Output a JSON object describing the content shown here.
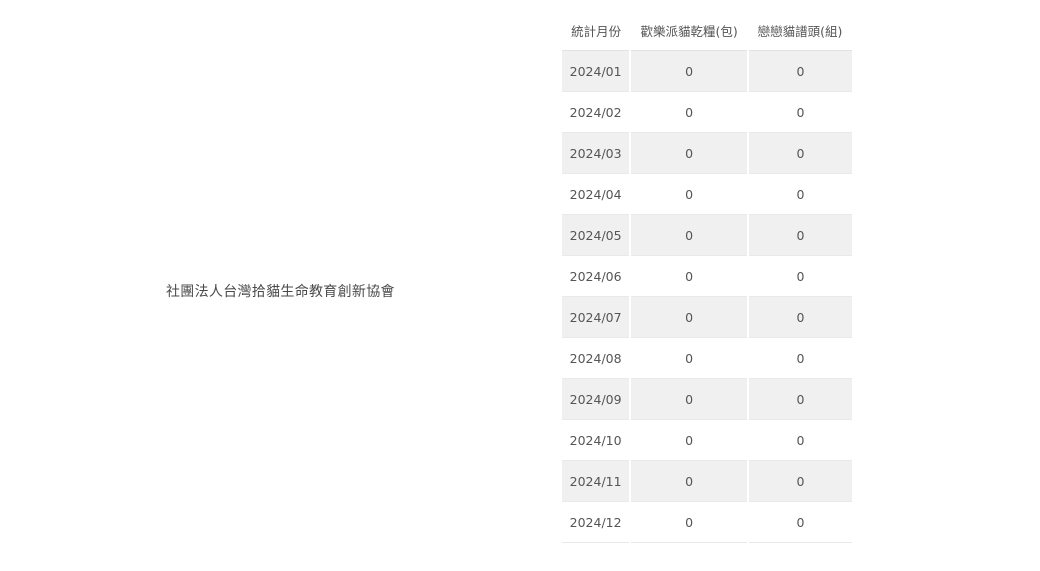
{
  "organization": {
    "name": "社團法人台灣拾貓生命教育創新協會"
  },
  "stats_table": {
    "headers": {
      "month": "統計月份",
      "food": "歡樂派貓乾糧(包)",
      "adopt": "戀戀貓譜頭(組)"
    },
    "rows": [
      {
        "month": "2024/01",
        "food": "0",
        "adopt": "0"
      },
      {
        "month": "2024/02",
        "food": "0",
        "adopt": "0"
      },
      {
        "month": "2024/03",
        "food": "0",
        "adopt": "0"
      },
      {
        "month": "2024/04",
        "food": "0",
        "adopt": "0"
      },
      {
        "month": "2024/05",
        "food": "0",
        "adopt": "0"
      },
      {
        "month": "2024/06",
        "food": "0",
        "adopt": "0"
      },
      {
        "month": "2024/07",
        "food": "0",
        "adopt": "0"
      },
      {
        "month": "2024/08",
        "food": "0",
        "adopt": "0"
      },
      {
        "month": "2024/09",
        "food": "0",
        "adopt": "0"
      },
      {
        "month": "2024/10",
        "food": "0",
        "adopt": "0"
      },
      {
        "month": "2024/11",
        "food": "0",
        "adopt": "0"
      },
      {
        "month": "2024/12",
        "food": "0",
        "adopt": "0"
      }
    ]
  }
}
